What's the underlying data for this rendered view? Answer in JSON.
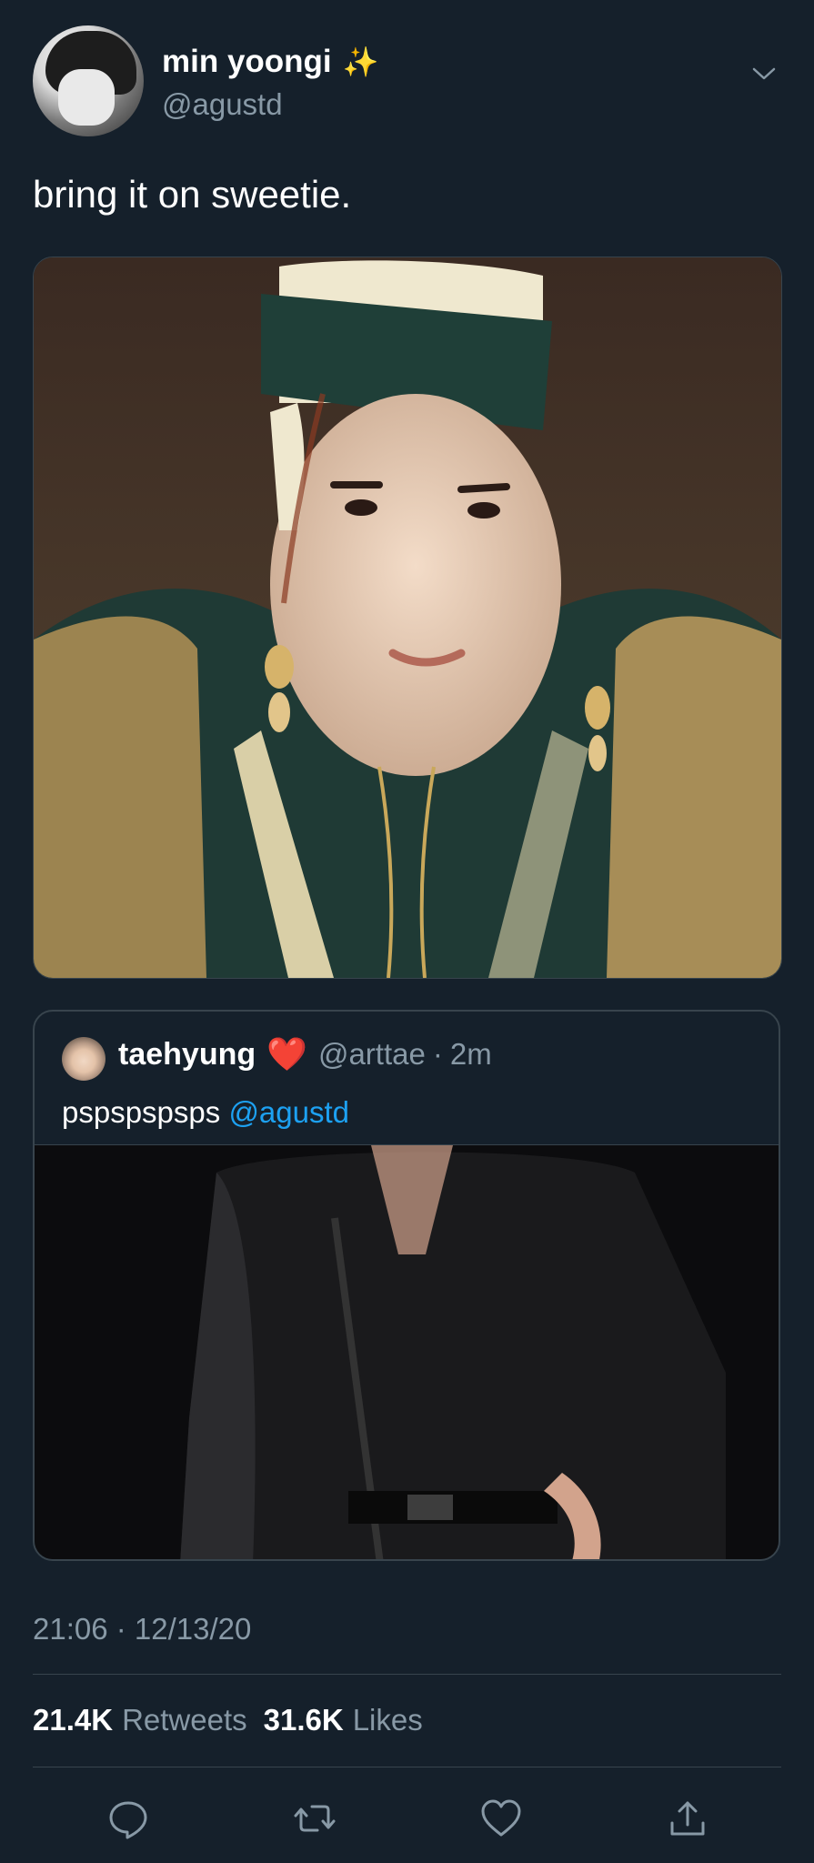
{
  "author": {
    "name": "min yoongi",
    "emoji": "✨",
    "handle": "@agustd"
  },
  "tweet": {
    "text": "bring it on sweetie.",
    "media_description": "photo"
  },
  "quoted_tweet": {
    "name": "taehyung",
    "emoji": "❤️",
    "handle": "@arttae",
    "separator": "·",
    "time": "2m",
    "text": "pspspspsps",
    "mention": "@agustd"
  },
  "meta": {
    "timestamp": "21:06 · 12/13/20",
    "retweets_count": "21.4K",
    "retweets_label": "Retweets",
    "likes_count": "31.6K",
    "likes_label": "Likes"
  },
  "icons": {
    "more": "chevron-down-icon",
    "reply": "reply-icon",
    "retweet": "retweet-icon",
    "like": "heart-icon",
    "share": "share-icon"
  },
  "colors": {
    "background": "#15202b",
    "border": "#38444d",
    "secondary_text": "#8899a6",
    "mention": "#1da1f2",
    "heart": "#e0245e"
  }
}
